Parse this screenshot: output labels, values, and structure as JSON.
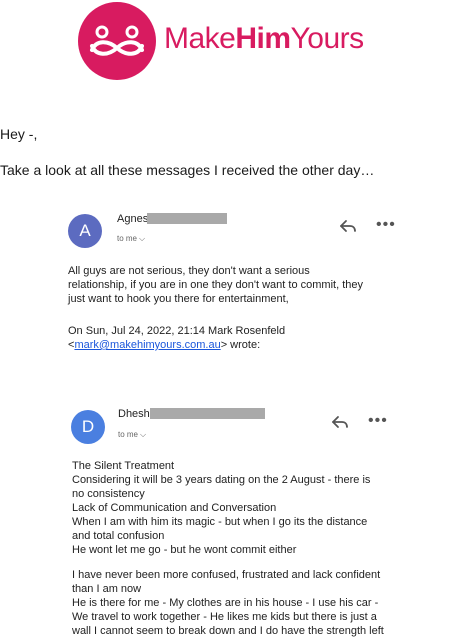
{
  "brand": {
    "name_light": "Make",
    "name_bold": "Him",
    "name_end": "Yours",
    "color": "#d81b60"
  },
  "greeting": "Hey -,",
  "intro": "Take a look at all these messages I received the other day…",
  "emails": [
    {
      "avatar_letter": "A",
      "avatar_color": "#5c6bc0",
      "sender": "Agnes",
      "to_me": "to me",
      "body": [
        "All guys are not serious, they don't want a serious",
        "relationship, if you are in one they don't want to commit, they",
        "just want to hook you there for entertainment,"
      ],
      "quote_line": "On Sun, Jul 24, 2022, 21:14 Mark Rosenfeld",
      "quote_open": "<",
      "quote_email": "mark@makehimyours.com.au",
      "quote_close": "> wrote:"
    },
    {
      "avatar_letter": "D",
      "avatar_color": "#4a7fe0",
      "sender": "Dhesh",
      "to_me": "to me",
      "body": [
        "The Silent Treatment",
        "Considering it will be 3 years dating on the 2 August - there is",
        "no consistency",
        "Lack of Communication and Conversation",
        "When I am with him its magic - but when I go its the distance",
        "and total confusion",
        "He wont let me go - but he wont commit either"
      ],
      "body2": [
        "I have never been more confused, frustrated and lack confident",
        "than I am now",
        "He is there for me - My clothes are in his house - I use his car -",
        "We travel to work together - He likes me kids but there is just a",
        "wall I cannot seem to break down and I do have the strength left"
      ]
    }
  ],
  "icons": {
    "reply": "reply-icon",
    "more": "more-icon",
    "chevron": "chevron-down-icon"
  }
}
